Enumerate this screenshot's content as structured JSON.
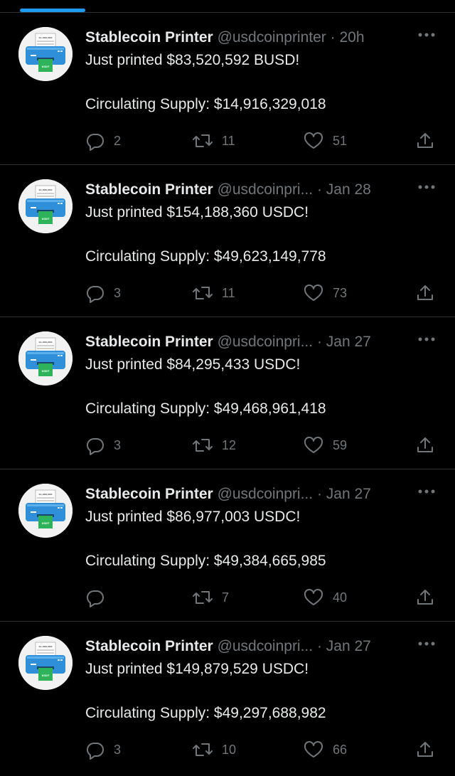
{
  "tweets": [
    {
      "display_name": "Stablecoin Printer",
      "handle": "@usdcoinprinter",
      "separator": "·",
      "time": "20h",
      "text": "Just printed $83,520,592 BUSD!",
      "supply": "Circulating Supply: $14,916,329,018",
      "replies": "2",
      "retweets": "11",
      "likes": "51"
    },
    {
      "display_name": "Stablecoin Printer",
      "handle": "@usdcoinpri...",
      "separator": "·",
      "time": "Jan 28",
      "text": "Just printed $154,188,360 USDC!",
      "supply": "Circulating Supply: $49,623,149,778",
      "replies": "3",
      "retweets": "11",
      "likes": "73"
    },
    {
      "display_name": "Stablecoin Printer",
      "handle": "@usdcoinpri...",
      "separator": "·",
      "time": "Jan 27",
      "text": "Just printed $84,295,433 USDC!",
      "supply": "Circulating Supply: $49,468,961,418",
      "replies": "3",
      "retweets": "12",
      "likes": "59"
    },
    {
      "display_name": "Stablecoin Printer",
      "handle": "@usdcoinpri...",
      "separator": "·",
      "time": "Jan 27",
      "text": "Just printed $86,977,003 USDC!",
      "supply": "Circulating Supply: $49,384,665,985",
      "replies": "",
      "retweets": "7",
      "likes": "40"
    },
    {
      "display_name": "Stablecoin Printer",
      "handle": "@usdcoinpri...",
      "separator": "·",
      "time": "Jan 27",
      "text": "Just printed $149,879,529 USDC!",
      "supply": "Circulating Supply: $49,297,688,982",
      "replies": "3",
      "retweets": "10",
      "likes": "66"
    }
  ],
  "avatar": {
    "paper_text": "$1,000,000",
    "bill_text": "USDT"
  },
  "icons": {
    "reply": "reply-icon",
    "retweet": "retweet-icon",
    "like": "heart-icon",
    "share": "share-icon",
    "more": "more-icon"
  },
  "colors": {
    "background": "#000000",
    "primary_text": "#e7e9ea",
    "secondary_text": "#71767b",
    "divider": "#2f3336",
    "accent": "#1d9bf0",
    "printer_blue": "#2f8fd8",
    "bill_green": "#2fb35a"
  }
}
